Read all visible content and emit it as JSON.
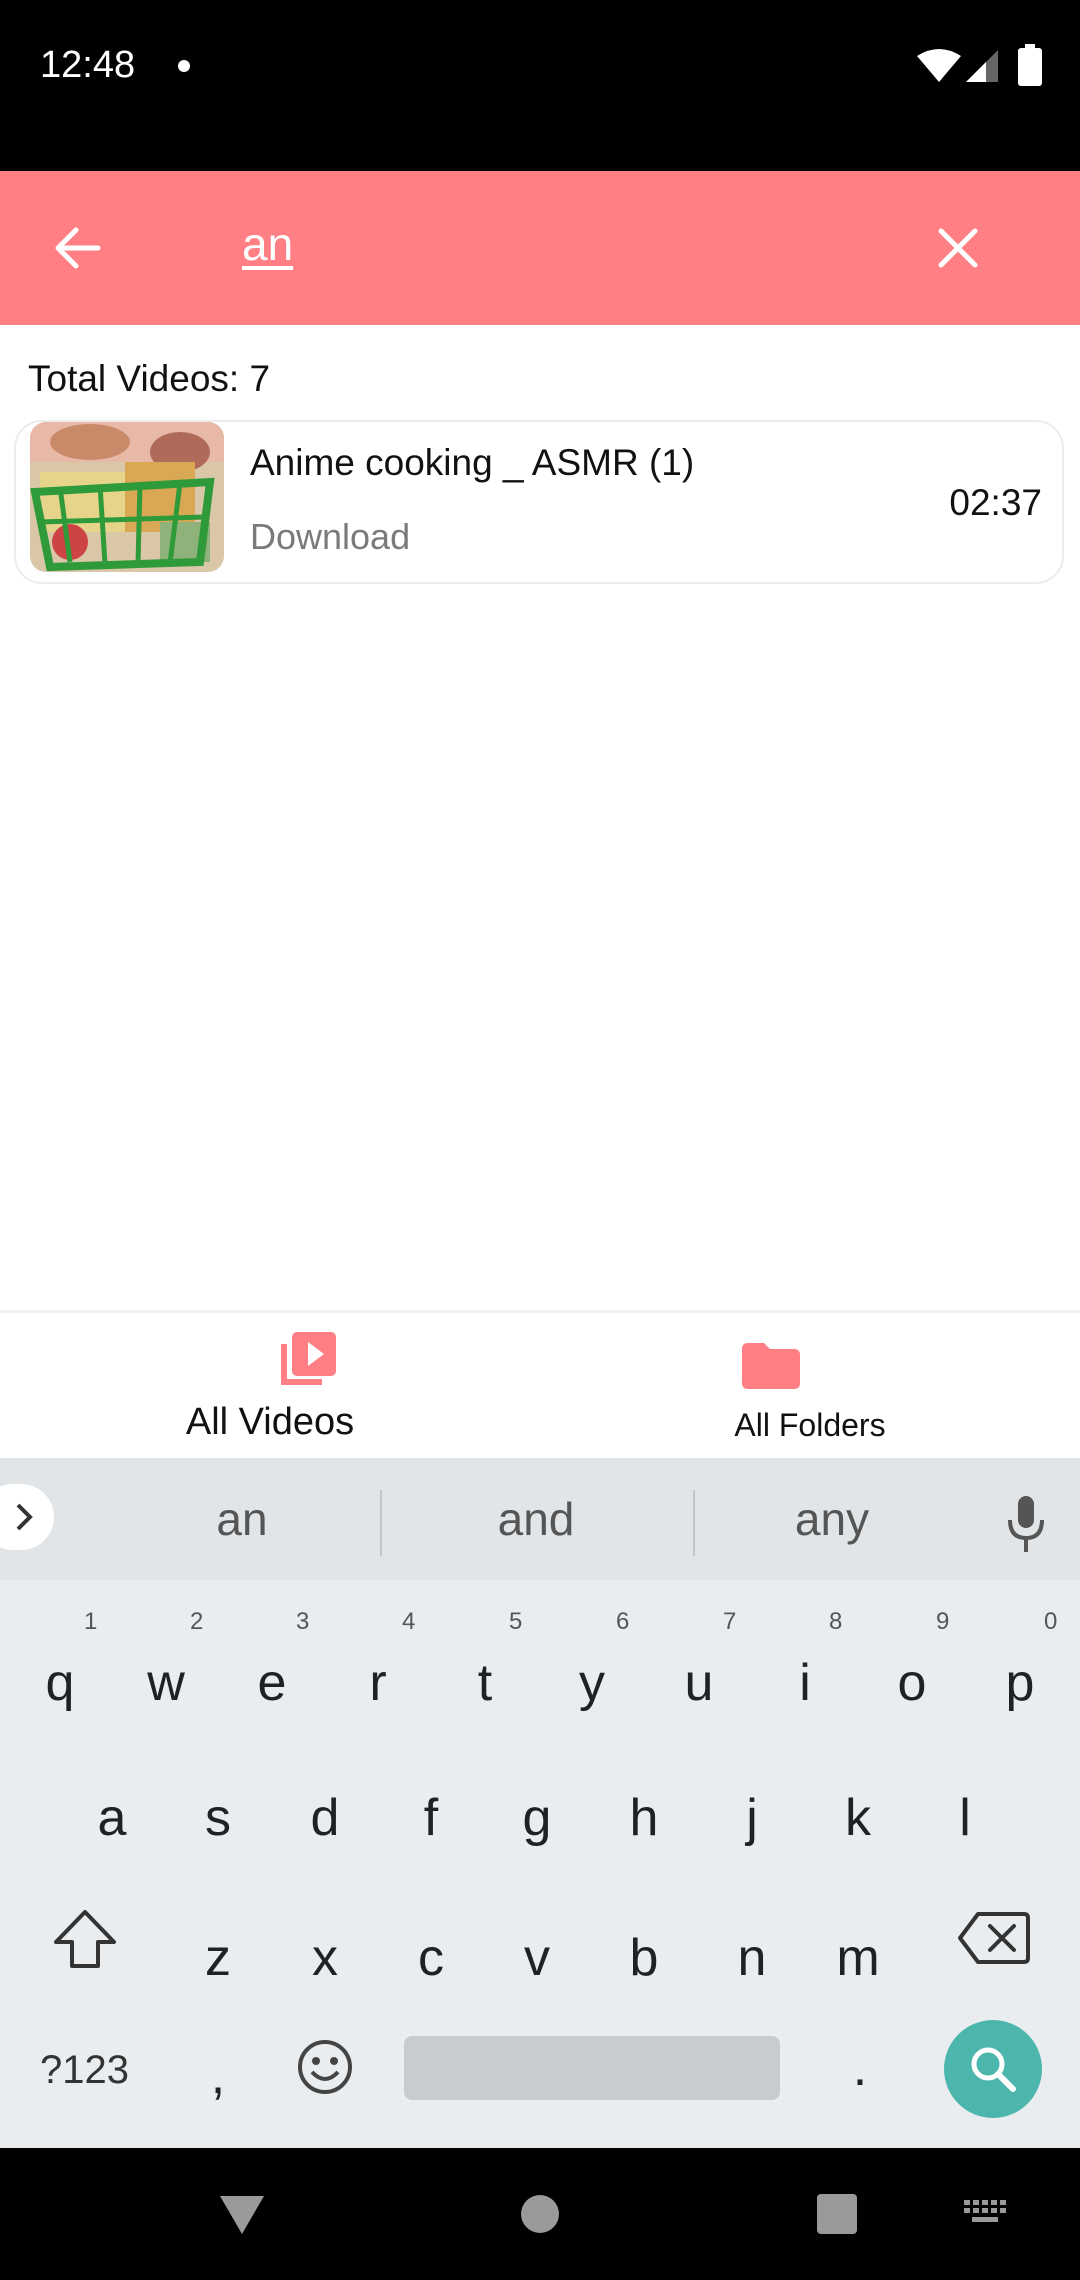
{
  "status_bar": {
    "time": "12:48"
  },
  "search": {
    "query": "an"
  },
  "content": {
    "total_label": "Total Videos: 7",
    "videos": [
      {
        "title": "Anime cooking _ ASMR (1)",
        "folder": "Download",
        "duration": "02:37"
      }
    ]
  },
  "bottom_nav": {
    "items": [
      {
        "label": "All Videos",
        "icon": "video-library-icon",
        "active": true
      },
      {
        "label": "All Folders",
        "icon": "folder-icon",
        "active": false
      }
    ]
  },
  "keyboard": {
    "suggestions": [
      "an",
      "and",
      "any"
    ],
    "row1": [
      "q",
      "w",
      "e",
      "r",
      "t",
      "y",
      "u",
      "i",
      "o",
      "p"
    ],
    "row1_hints": [
      "1",
      "2",
      "3",
      "4",
      "5",
      "6",
      "7",
      "8",
      "9",
      "0"
    ],
    "row2": [
      "a",
      "s",
      "d",
      "f",
      "g",
      "h",
      "j",
      "k",
      "l"
    ],
    "row3": [
      "z",
      "x",
      "c",
      "v",
      "b",
      "n",
      "m"
    ],
    "symbols_label": "?123",
    "comma": ",",
    "period": "."
  },
  "colors": {
    "accent": "#FF7F84",
    "search_key": "#4DB6AC"
  }
}
